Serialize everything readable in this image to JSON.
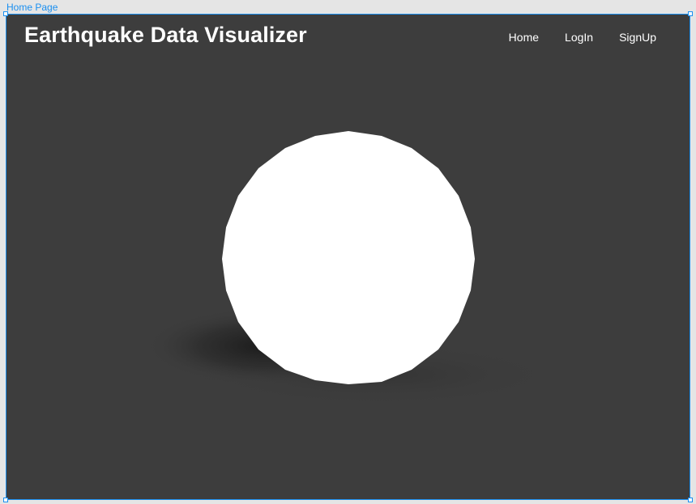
{
  "frame": {
    "label": "Home Page"
  },
  "header": {
    "title": "Earthquake Data Visualizer",
    "nav": [
      {
        "label": "Home"
      },
      {
        "label": "LogIn"
      },
      {
        "label": "SignUp"
      }
    ]
  },
  "colors": {
    "background": "#3d3d3d",
    "text": "#ffffff",
    "globe": "#ffffff",
    "selection": "#1a8ff0"
  }
}
